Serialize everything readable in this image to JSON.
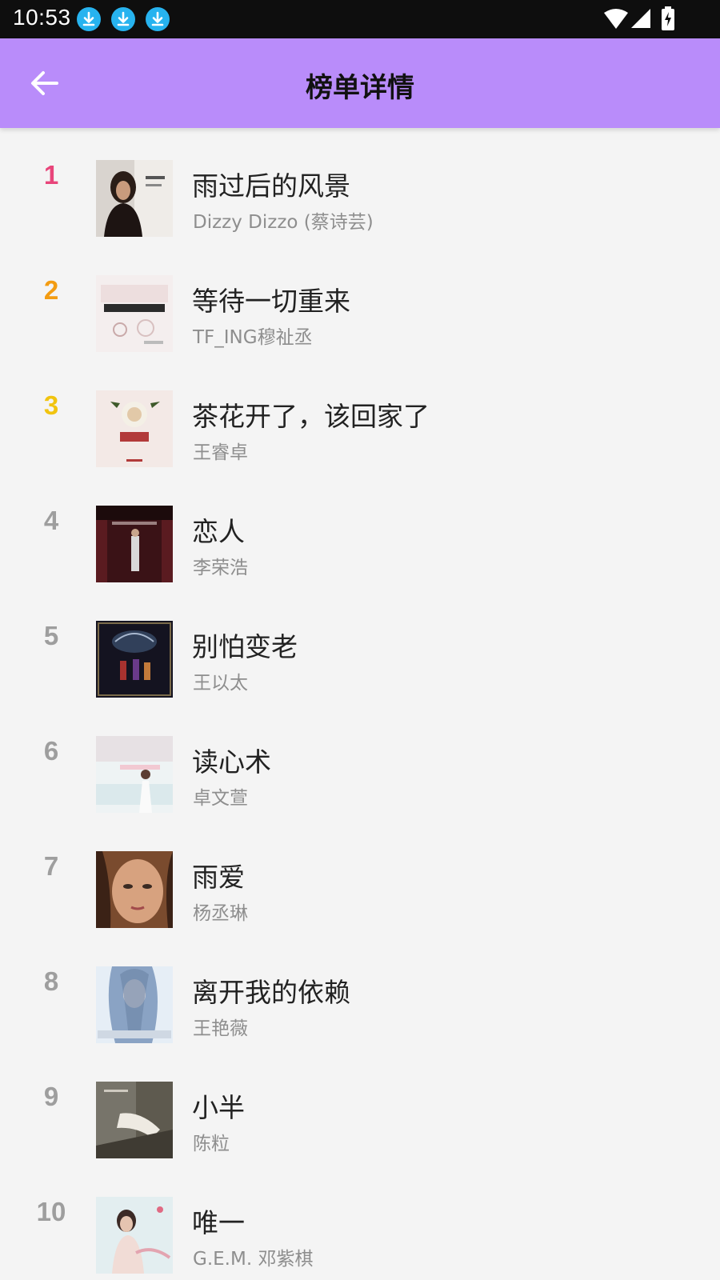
{
  "status": {
    "time": "10:53",
    "notification_icons": [
      "download-icon",
      "download-icon",
      "download-icon"
    ],
    "system_icons": [
      "wifi-icon",
      "cell-signal-icon",
      "battery-charging-icon"
    ]
  },
  "app_bar": {
    "title": "榜单详情",
    "back_icon": "arrow-back-icon",
    "color": "#b98cfa"
  },
  "rank_colors": {
    "first": "#e8457a",
    "second": "#f39c12",
    "third": "#f1c40f",
    "other": "#9e9e9e"
  },
  "songs": [
    {
      "rank": "1",
      "title": "雨过后的风景",
      "artist": "Dizzy Dizzo (蔡诗芸)"
    },
    {
      "rank": "2",
      "title": "等待一切重来",
      "artist": "TF_ING穆祉丞"
    },
    {
      "rank": "3",
      "title": "茶花开了，该回家了",
      "artist": "王睿卓"
    },
    {
      "rank": "4",
      "title": "恋人",
      "artist": "李荣浩"
    },
    {
      "rank": "5",
      "title": "别怕变老",
      "artist": "王以太"
    },
    {
      "rank": "6",
      "title": "读心术",
      "artist": "卓文萱"
    },
    {
      "rank": "7",
      "title": "雨爱",
      "artist": "杨丞琳"
    },
    {
      "rank": "8",
      "title": "离开我的依赖",
      "artist": "王艳薇"
    },
    {
      "rank": "9",
      "title": "小半",
      "artist": "陈粒"
    },
    {
      "rank": "10",
      "title": "唯一",
      "artist": "G.E.M. 邓紫棋"
    }
  ]
}
